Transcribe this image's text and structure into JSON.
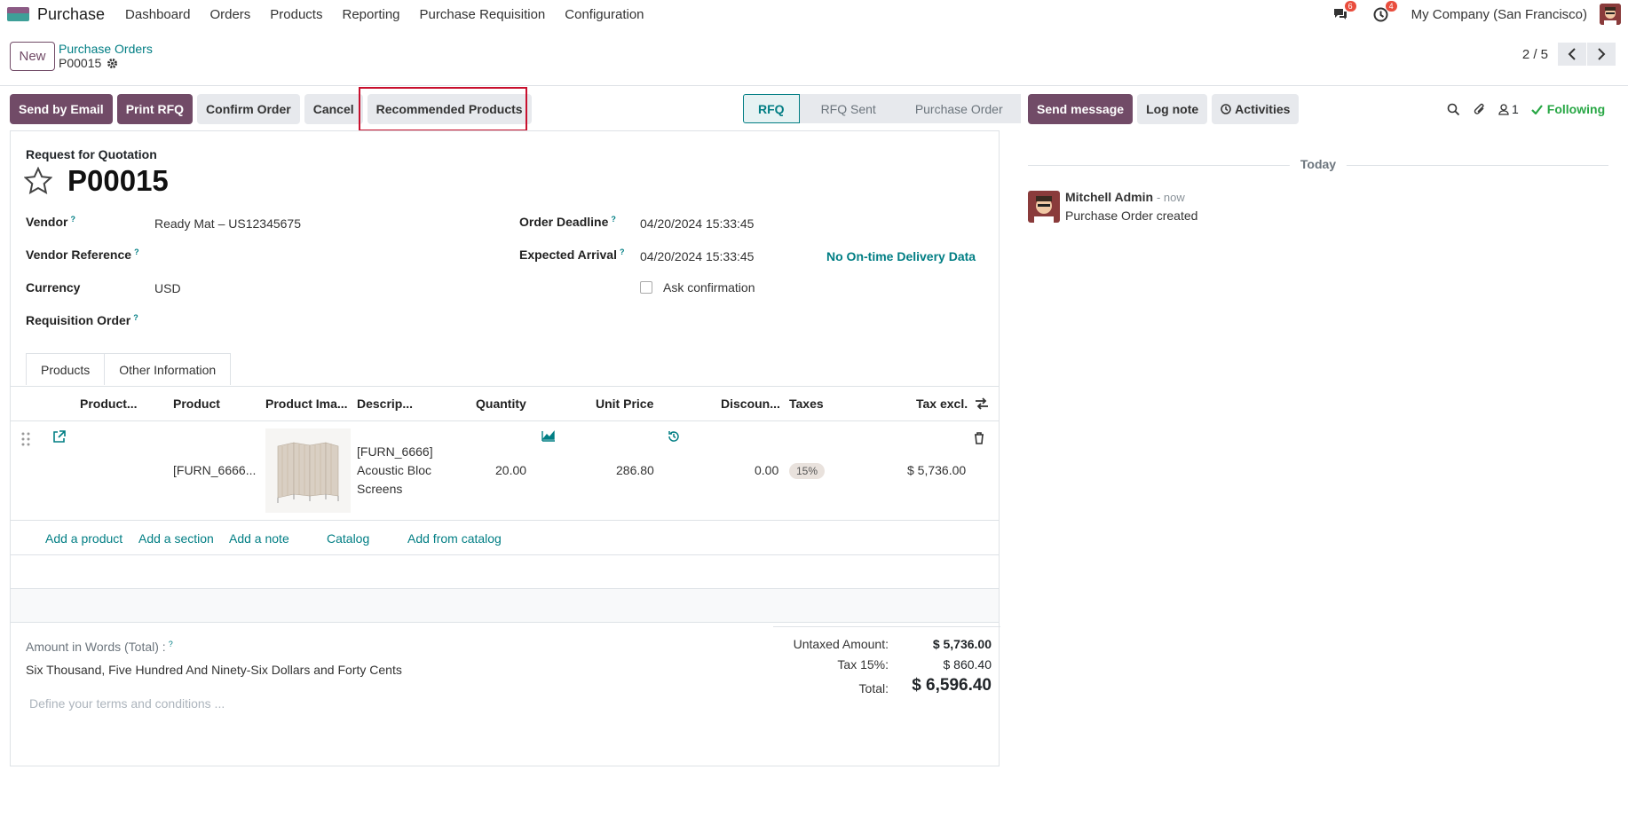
{
  "app": {
    "name": "Purchase"
  },
  "menu": [
    "Dashboard",
    "Orders",
    "Products",
    "Reporting",
    "Purchase Requisition",
    "Configuration"
  ],
  "systray": {
    "messages_count": "6",
    "activities_count": "4",
    "company": "My Company (San Francisco)"
  },
  "control": {
    "new_label": "New",
    "breadcrumb_parent": "Purchase Orders",
    "breadcrumb_current": "P00015",
    "pager": "2 / 5"
  },
  "actions": {
    "send_email": "Send by Email",
    "print_rfq": "Print RFQ",
    "confirm": "Confirm Order",
    "cancel": "Cancel",
    "recommended": "Recommended Products"
  },
  "status": [
    "RFQ",
    "RFQ Sent",
    "Purchase Order"
  ],
  "form": {
    "doc_type": "Request for Quotation",
    "name": "P00015",
    "vendor_label": "Vendor",
    "vendor": "Ready Mat – US12345675",
    "vendor_ref_label": "Vendor Reference",
    "currency_label": "Currency",
    "currency": "USD",
    "requisition_label": "Requisition Order",
    "deadline_label": "Order Deadline",
    "deadline": "04/20/2024 15:33:45",
    "arrival_label": "Expected Arrival",
    "arrival": "04/20/2024 15:33:45",
    "ontime": "No On-time Delivery Data",
    "ask_confirm": "Ask confirmation"
  },
  "tabs": [
    "Products",
    "Other Information"
  ],
  "table": {
    "headers": [
      "Product...",
      "Product",
      "Product Ima...",
      "Descrip...",
      "Quantity",
      "Unit Price",
      "Discoun...",
      "Taxes",
      "Tax excl."
    ],
    "row": {
      "product": "[FURN_6666...",
      "desc1": "[FURN_6666]",
      "desc2": "Acoustic Bloc",
      "desc3": "Screens",
      "qty": "20.00",
      "price": "286.80",
      "discount": "0.00",
      "tax": "15%",
      "subtotal": "$ 5,736.00"
    }
  },
  "add_links": [
    "Add a product",
    "Add a section",
    "Add a note",
    "Catalog",
    "Add from catalog"
  ],
  "footer": {
    "words_label": "Amount in Words (Total) :",
    "words": "Six Thousand, Five Hundred And Ninety-Six Dollars and Forty Cents",
    "terms_placeholder": "Define your terms and conditions ...",
    "untaxed_label": "Untaxed Amount:",
    "untaxed": "$ 5,736.00",
    "tax_label": "Tax 15%:",
    "tax": "$ 860.40",
    "total_label": "Total:",
    "total": "$ 6,596.40"
  },
  "chatter": {
    "send_message": "Send message",
    "log_note": "Log note",
    "activities": "Activities",
    "followers": "1",
    "following": "Following",
    "today": "Today",
    "author": "Mitchell Admin",
    "time": "- now",
    "message": "Purchase Order created"
  }
}
